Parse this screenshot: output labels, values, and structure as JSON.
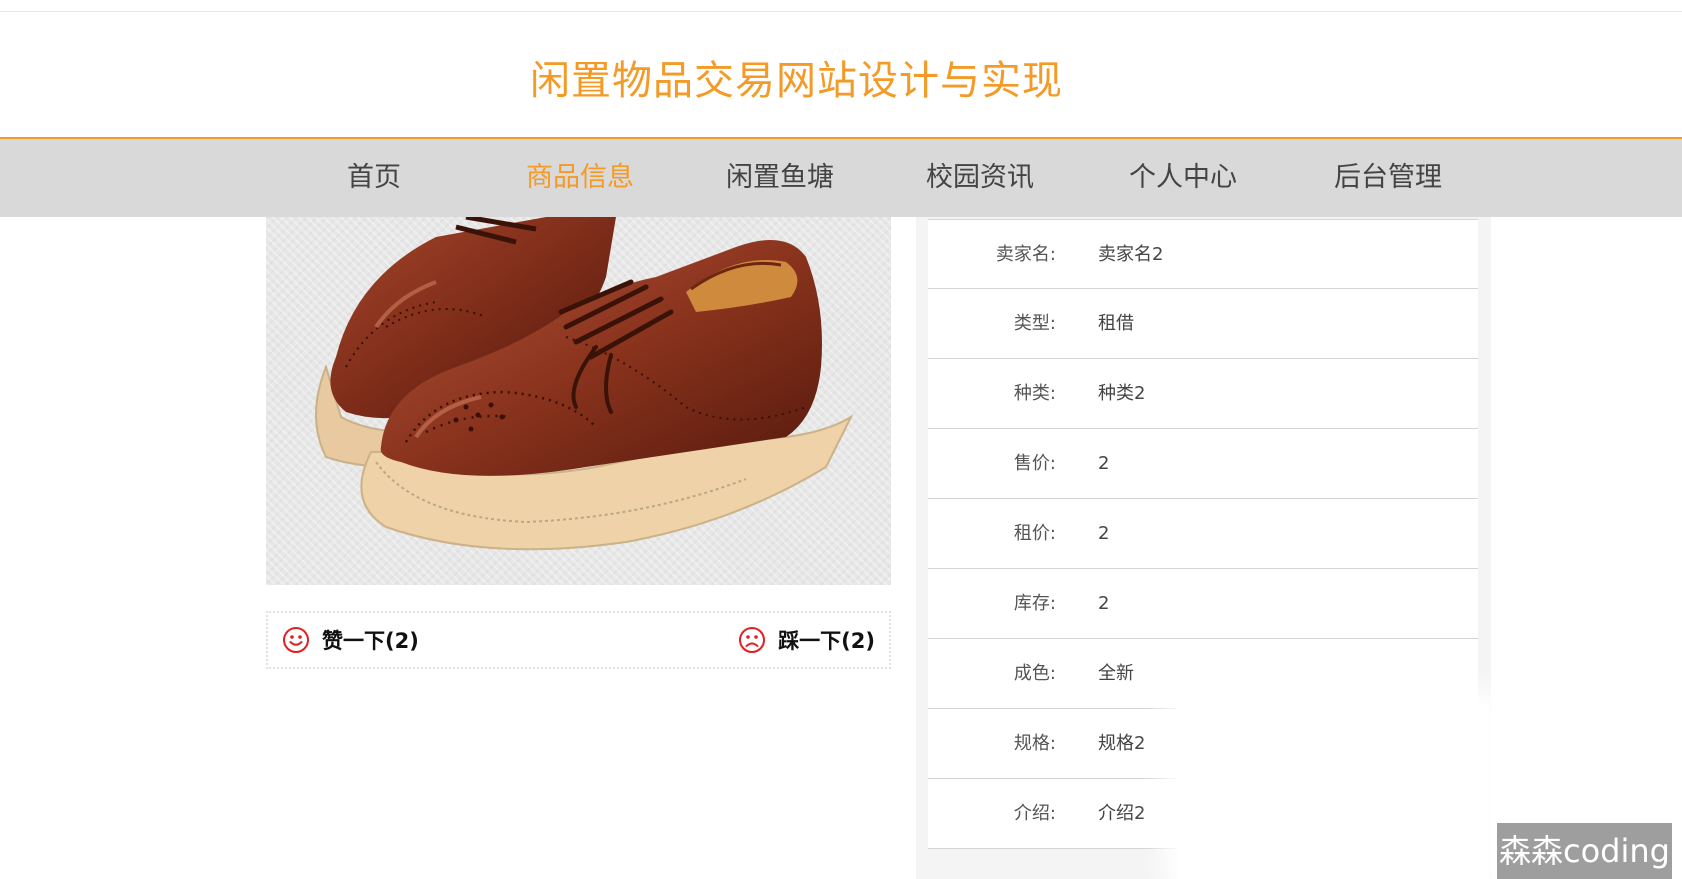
{
  "site": {
    "title": "闲置物品交易网站设计与实现"
  },
  "nav": {
    "items": [
      {
        "label": "首页"
      },
      {
        "label": "商品信息"
      },
      {
        "label": "闲置鱼塘"
      },
      {
        "label": "校园资讯"
      },
      {
        "label": "个人中心"
      },
      {
        "label": "后台管理"
      }
    ],
    "active_index": 1,
    "accent_color": "#f39a27"
  },
  "product": {
    "image_icon": "brown-brogue-shoes",
    "like_label": "赞一下(2)",
    "dislike_label": "踩一下(2)",
    "like_icon": "smile-icon",
    "dislike_icon": "frown-icon"
  },
  "details": [
    {
      "label": "卖家名:",
      "value": "卖家名2"
    },
    {
      "label": "类型:",
      "value": "租借"
    },
    {
      "label": "种类:",
      "value": "种类2"
    },
    {
      "label": "售价:",
      "value": "2"
    },
    {
      "label": "租价:",
      "value": "2"
    },
    {
      "label": "库存:",
      "value": "2"
    },
    {
      "label": "成色:",
      "value": "全新"
    },
    {
      "label": "规格:",
      "value": "规格2"
    },
    {
      "label": "介绍:",
      "value": "介绍2"
    }
  ],
  "watermark": "森森coding"
}
